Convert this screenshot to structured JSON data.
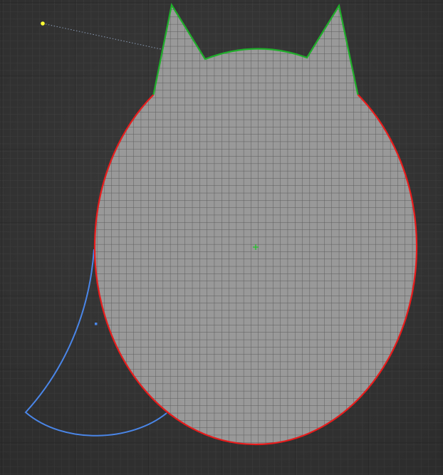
{
  "viewport": {
    "mode": "2d-vector-edit"
  },
  "colors": {
    "background": "#3b3b3b",
    "grid_minor": "#4a4a4a",
    "grid_major": "#2c2c2c",
    "shape_fill": "#999999",
    "shape_grid": "#5a5a5a",
    "body_outline": "#e81c1c",
    "ears_outline": "#1fae2a",
    "tail_outline": "#4a86e8",
    "light_point": "#ffff33",
    "center_marker": "#22c22a"
  },
  "objects": [
    {
      "id": "body",
      "kind": "ellipse-curve",
      "outline": "red",
      "selected": true
    },
    {
      "id": "ears",
      "kind": "polyline",
      "outline": "green",
      "selected": true
    },
    {
      "id": "tail",
      "kind": "arc-curve",
      "outline": "blue",
      "selected": false
    },
    {
      "id": "light",
      "kind": "point-handle",
      "outline": "yellow",
      "selected": false
    }
  ],
  "icons": [
    "center-marker-icon",
    "light-point-icon",
    "pivot-dot-icon"
  ]
}
